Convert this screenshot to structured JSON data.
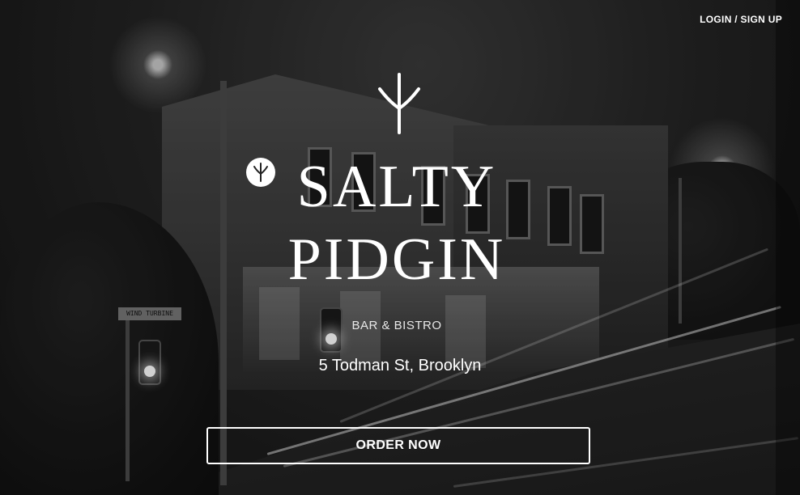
{
  "header": {
    "login_label": "LOGIN / SIGN UP"
  },
  "hero": {
    "logo_icon": "pidgin-footprint-icon",
    "badge_icon": "circle-footprint-icon",
    "title": "SALTY\nPIDGIN",
    "subtitle": "BAR & BISTRO",
    "address": "5 Todman St, Brooklyn",
    "order_label": "ORDER NOW"
  },
  "background": {
    "street_sign": "WIND TURBINE",
    "tone": "black-and-white night street photo"
  },
  "colors": {
    "text": "#ffffff",
    "button_border": "#ffffff"
  }
}
